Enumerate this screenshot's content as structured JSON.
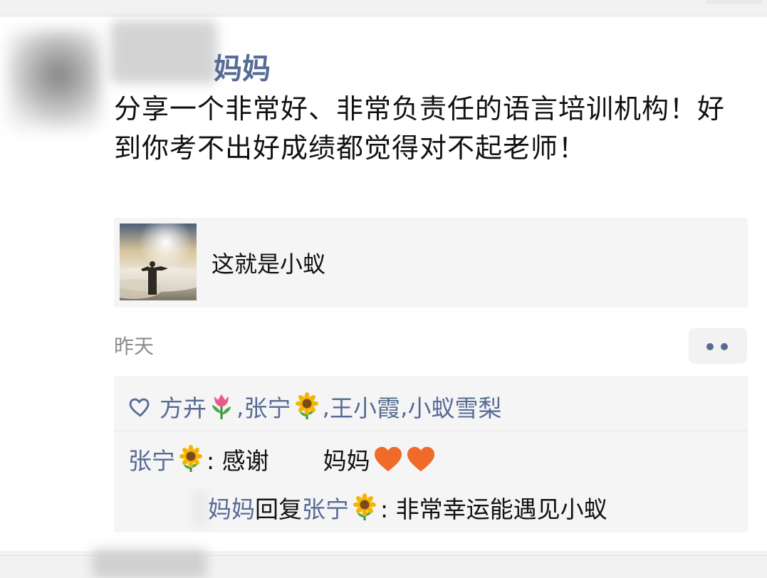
{
  "post": {
    "author_suffix": "妈妈",
    "text": "分享一个非常好、非常负责任的语言培训机构！好到你考不出好成绩都觉得对不起老师！",
    "link_title": "这就是小蚁",
    "timestamp": "昨天"
  },
  "likes": {
    "icon": "heart-outline-icon",
    "names": [
      {
        "name": "方卉",
        "emoji": "tulip-icon",
        "sep": ", "
      },
      {
        "name": "张宁",
        "emoji": "sunflower-icon",
        "sep": ", "
      },
      {
        "name": "王小霞",
        "sep": ", "
      },
      {
        "name": "小蚁雪梨"
      }
    ]
  },
  "comments": [
    {
      "author": "张宁",
      "text_a": ": 感谢",
      "text_b": "妈妈"
    },
    {
      "from_suffix": "妈妈",
      "reply_word": "回复",
      "to": "张宁",
      "text": ": 非常幸运能遇见小蚁"
    }
  ],
  "colors": {
    "link_blue": "#576b95",
    "text": "#111111",
    "muted": "#8c8c8c"
  }
}
